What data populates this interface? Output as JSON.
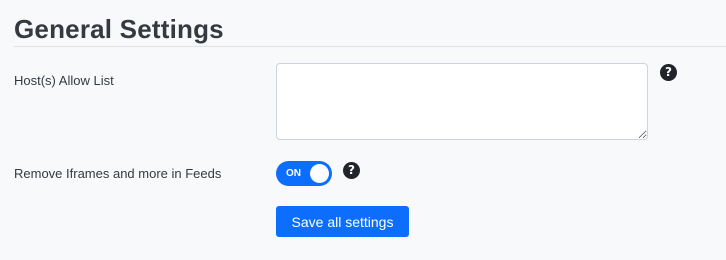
{
  "section": {
    "title": "General Settings"
  },
  "hosts_allow_list": {
    "label": "Host(s) Allow List",
    "value": "",
    "help_icon": "question-circle-icon"
  },
  "remove_iframes": {
    "label": "Remove Iframes and more in Feeds",
    "toggle_state": "ON",
    "help_icon": "question-circle-icon"
  },
  "actions": {
    "save_label": "Save all settings"
  },
  "colors": {
    "accent": "#0d6efd",
    "background": "#f8f9fa",
    "text": "#343a40",
    "help_icon": "#212529"
  }
}
